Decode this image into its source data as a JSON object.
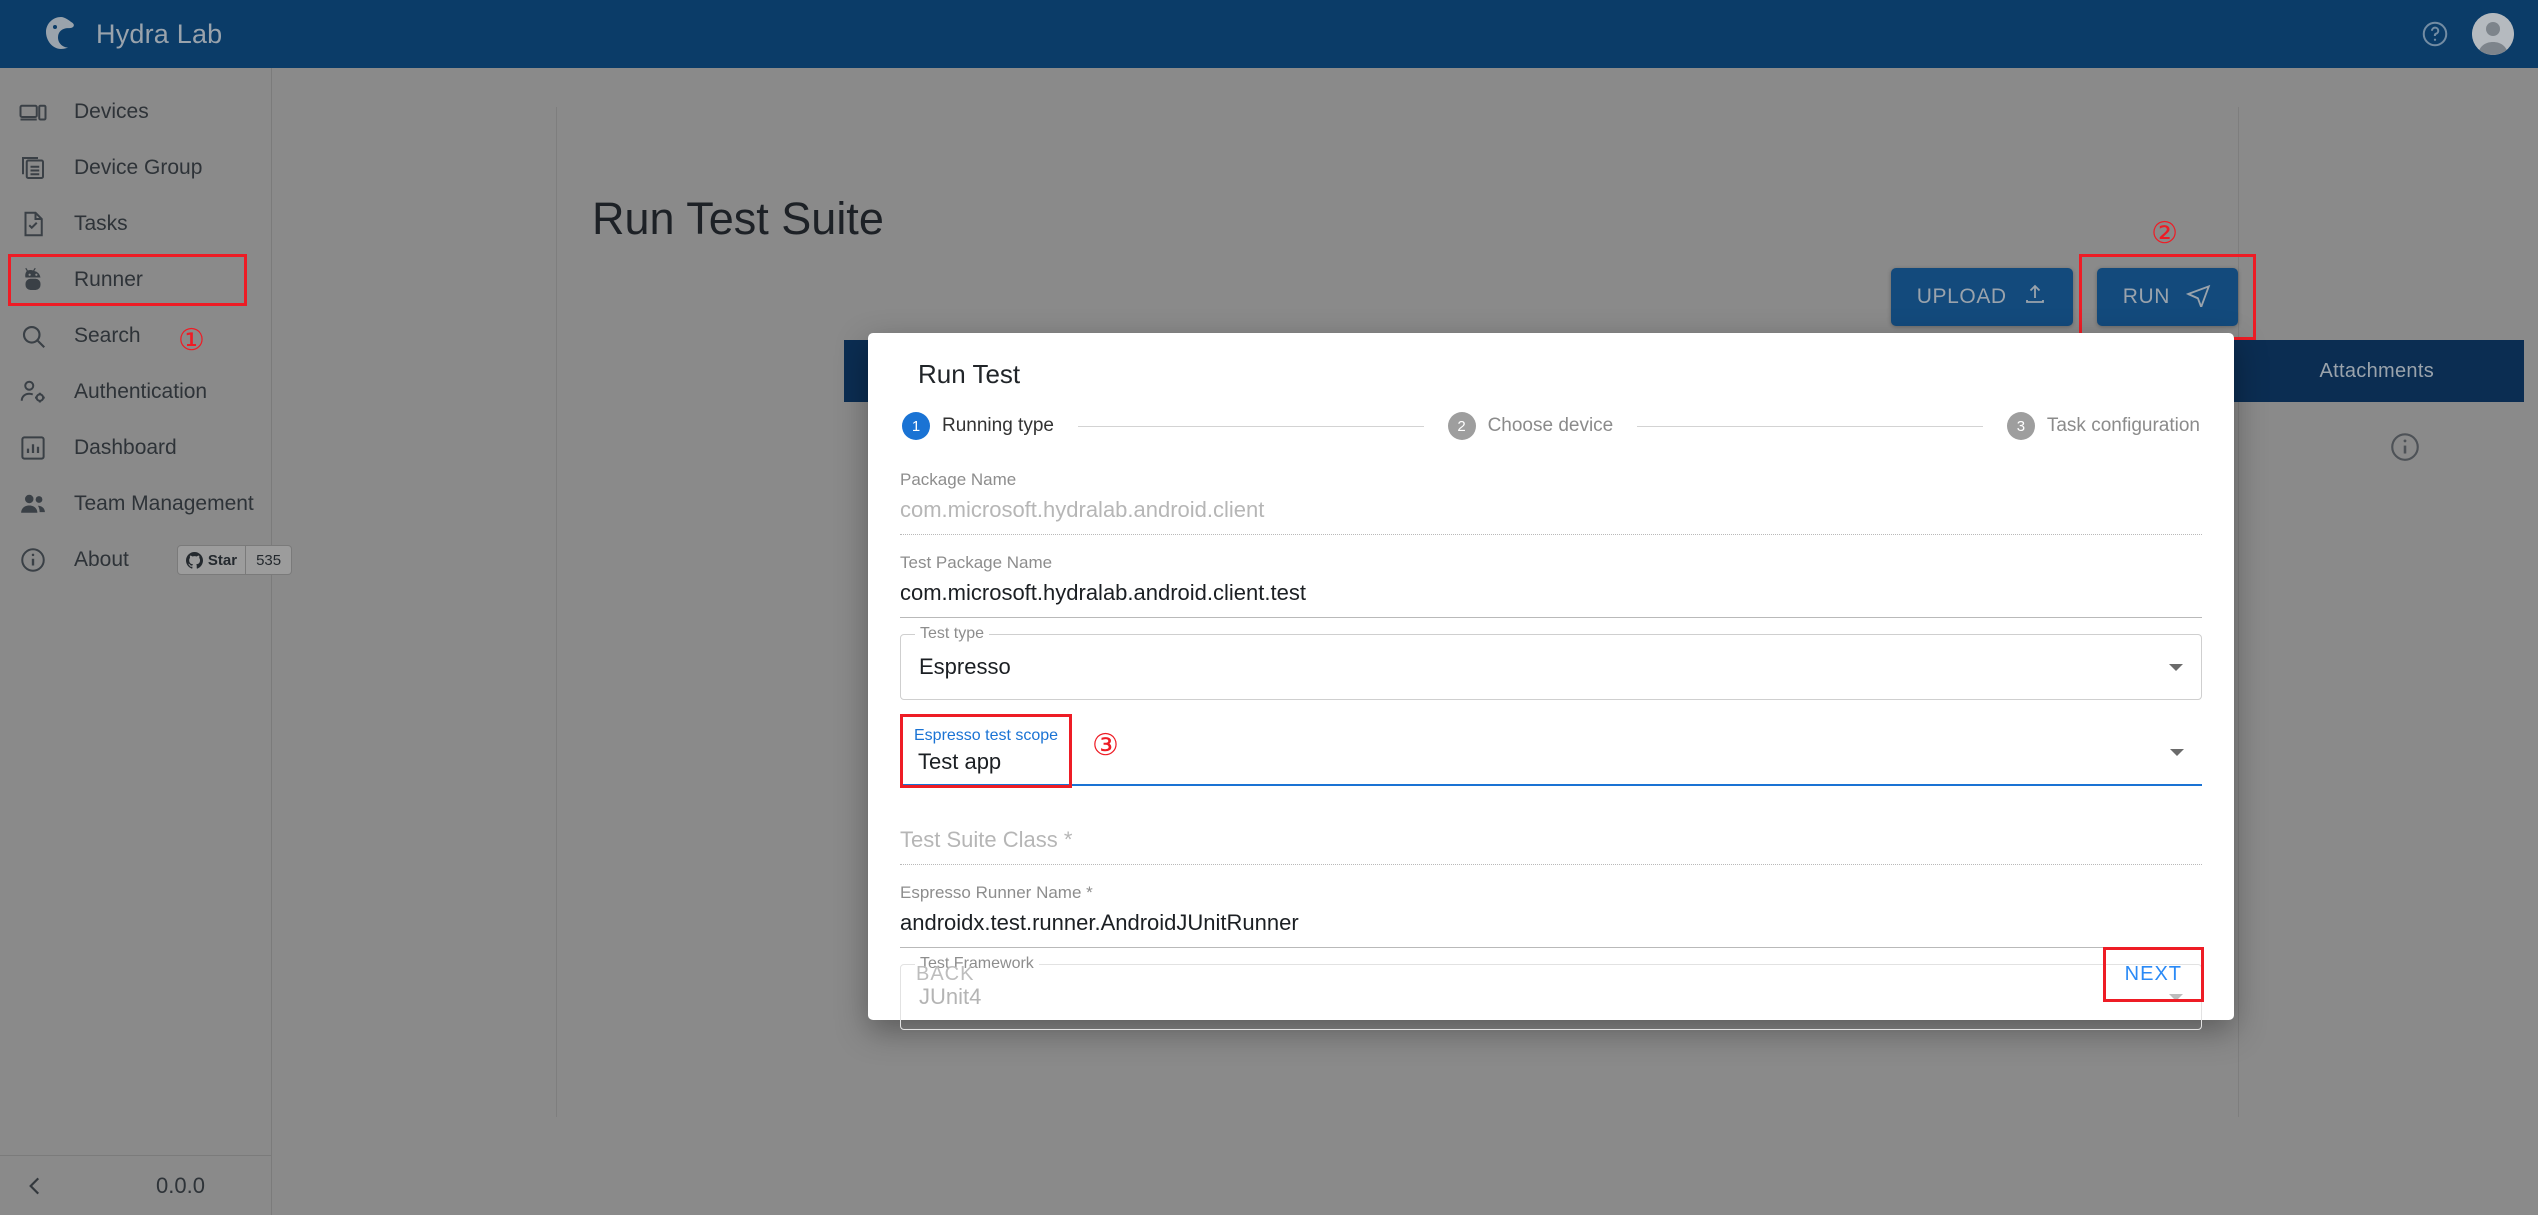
{
  "app": {
    "brand": "Hydra Lab",
    "brand_color": "#0b3c68",
    "accent_color": "#1a73d4",
    "marker_color": "#ee1c25",
    "version": "0.0.0"
  },
  "topbar": {
    "help_icon": "help-circle-icon",
    "account_icon": "account-avatar-icon"
  },
  "sidebar": {
    "items": [
      {
        "label": "Devices",
        "icon": "devices-icon",
        "highlight": false
      },
      {
        "label": "Device Group",
        "icon": "device-group-icon",
        "highlight": false
      },
      {
        "label": "Tasks",
        "icon": "tasks-icon",
        "highlight": false
      },
      {
        "label": "Runner",
        "icon": "android-robot-icon",
        "highlight": true
      },
      {
        "label": "Search",
        "icon": "search-icon",
        "highlight": false
      },
      {
        "label": "Authentication",
        "icon": "user-settings-icon",
        "highlight": false
      },
      {
        "label": "Dashboard",
        "icon": "dashboard-icon",
        "highlight": false
      },
      {
        "label": "Team Management",
        "icon": "people-icon",
        "highlight": false
      },
      {
        "label": "About",
        "icon": "info-icon",
        "highlight": false
      }
    ],
    "github_badge": {
      "label": "Star",
      "count": "535",
      "icon": "github-icon"
    },
    "collapse_icon": "chevron-left-icon"
  },
  "markers": {
    "one": "①",
    "two": "②",
    "three": "③"
  },
  "page": {
    "title": "Run Test Suite",
    "upload_label": "UPLOAD",
    "upload_icon": "upload-icon",
    "run_label": "RUN",
    "run_icon": "send-icon",
    "tab_attachments": "Attachments",
    "info_icon": "info-circle-icon"
  },
  "dialog": {
    "title": "Run Test",
    "steps": [
      {
        "num": "1",
        "label": "Running type",
        "active": true
      },
      {
        "num": "2",
        "label": "Choose device",
        "active": false
      },
      {
        "num": "3",
        "label": "Task configuration",
        "active": false
      }
    ],
    "fields": {
      "package_name": {
        "label": "Package Name",
        "value": "com.microsoft.hydralab.android.client",
        "disabled": true
      },
      "test_package": {
        "label": "Test Package Name",
        "value": "com.microsoft.hydralab.android.client.test",
        "disabled": false
      },
      "test_type": {
        "label": "Test type",
        "value": "Espresso",
        "disabled": false
      },
      "espresso_scope": {
        "label": "Espresso test scope",
        "value": "Test app",
        "disabled": false
      },
      "test_suite": {
        "label": "Test Suite Class *",
        "value": "",
        "disabled": true
      },
      "runner_name": {
        "label": "Espresso Runner Name *",
        "value": "androidx.test.runner.AndroidJUnitRunner",
        "disabled": false
      },
      "test_framework": {
        "label": "Test Framework",
        "value": "JUnit4",
        "disabled": true
      }
    },
    "back_label": "BACK",
    "next_label": "NEXT"
  }
}
